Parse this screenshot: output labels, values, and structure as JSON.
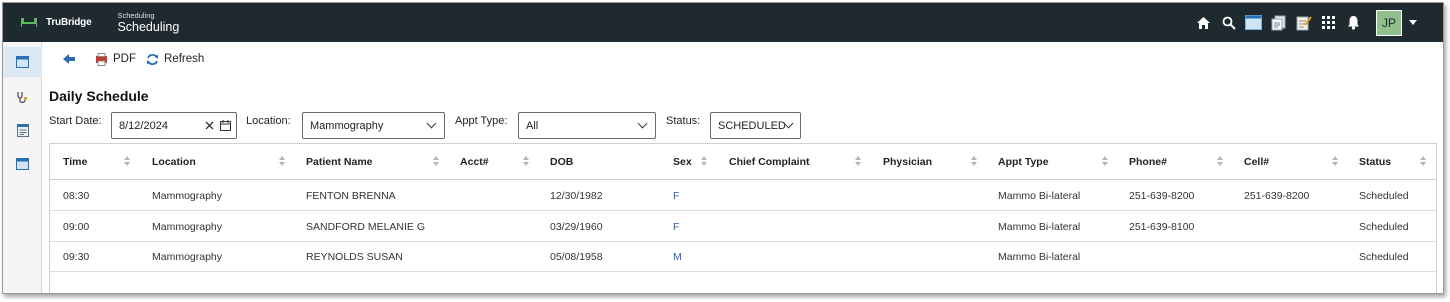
{
  "header": {
    "brand": "TruBridge",
    "module_small": "Scheduling",
    "module_title": "Scheduling",
    "avatar_initials": "JP",
    "icons": [
      "home-icon",
      "search-icon",
      "window-icon",
      "documents-icon",
      "notes-icon",
      "apps-grid-icon",
      "bell-icon"
    ]
  },
  "sidebar": {
    "items": [
      {
        "icon": "calendar-icon",
        "active": true
      },
      {
        "icon": "stethoscope-icon",
        "active": false
      },
      {
        "icon": "form-icon",
        "active": false
      },
      {
        "icon": "schedule-icon",
        "active": false
      }
    ]
  },
  "toolbar": {
    "pdf_label": "PDF",
    "refresh_label": "Refresh"
  },
  "page_title": "Daily Schedule",
  "filters": {
    "start_date_label": "Start Date:",
    "start_date_value": "8/12/2024",
    "location_label": "Location:",
    "location_value": "Mammography",
    "appt_type_label": "Appt Type:",
    "appt_type_value": "All",
    "status_label": "Status:",
    "status_value": "SCHEDULED"
  },
  "table": {
    "columns": [
      "Time",
      "Location",
      "Patient Name",
      "Acct#",
      "DOB",
      "Sex",
      "Chief Complaint",
      "Physician",
      "Appt Type",
      "Phone#",
      "Cell#",
      "Status"
    ],
    "rows": [
      [
        "08:30",
        "Mammography",
        "FENTON BRENNA",
        "",
        "12/30/1982",
        "F",
        "",
        "",
        "Mammo Bi-lateral",
        "251-639-8200",
        "251-639-8200",
        "Scheduled"
      ],
      [
        "09:00",
        "Mammography",
        "SANDFORD MELANIE G",
        "",
        "03/29/1960",
        "F",
        "",
        "",
        "Mammo Bi-lateral",
        "251-639-8100",
        "",
        "Scheduled"
      ],
      [
        "09:30",
        "Mammography",
        "REYNOLDS SUSAN",
        "",
        "05/08/1958",
        "M",
        "",
        "",
        "Mammo Bi-lateral",
        "",
        "",
        "Scheduled"
      ]
    ]
  },
  "colors": {
    "topbar": "#1f2a30",
    "accent": "#2a6fb5",
    "sex_text": "#2a5fa8"
  }
}
